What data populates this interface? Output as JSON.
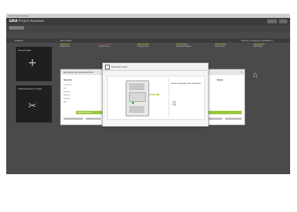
{
  "window": {
    "title": "GIRA Project Assistant"
  },
  "header": {
    "logo_brand": "GIRA",
    "logo_product": "Project Assistant"
  },
  "columns": {
    "left": "Gebäude",
    "main": "Mein Projekt",
    "right": "Sortieren ▸ Kategorie auswählen ▾"
  },
  "rooms": [
    {
      "status": "Gebäudeteil",
      "name": "Erdgeschoss"
    },
    {
      "status": "Raumausstattung",
      "name": "Vorraum Links"
    },
    {
      "status": "Dokumentation",
      "name": "Obergeschoss"
    },
    {
      "status": "Dokumentation",
      "name": "Abstellraum Rechts"
    },
    {
      "status": "Dokumentation",
      "name": "Küche Essen"
    },
    {
      "status": "Dokumentation",
      "name": "Bad Toilette"
    }
  ],
  "tiles": {
    "new_project": "Neues Projekt",
    "devices": "Gebäudetechnik & Geräte"
  },
  "dialog_back": {
    "title": "Einrichtung der Gebäudetechnik",
    "col_left": "Bereiche",
    "col_right": "Status",
    "lines": [
      "Lichtmenü",
      "Flur",
      "Eingang",
      "Wohnen",
      "Terrasse",
      "Bad"
    ],
    "green_label": "Geräte hinzufügen"
  },
  "dialog_front": {
    "title": "Übertragung läuft",
    "target_label": "Neues Gebäude wird verbunden"
  },
  "colors": {
    "accent": "#9bc93a",
    "warning": "#e05050"
  }
}
